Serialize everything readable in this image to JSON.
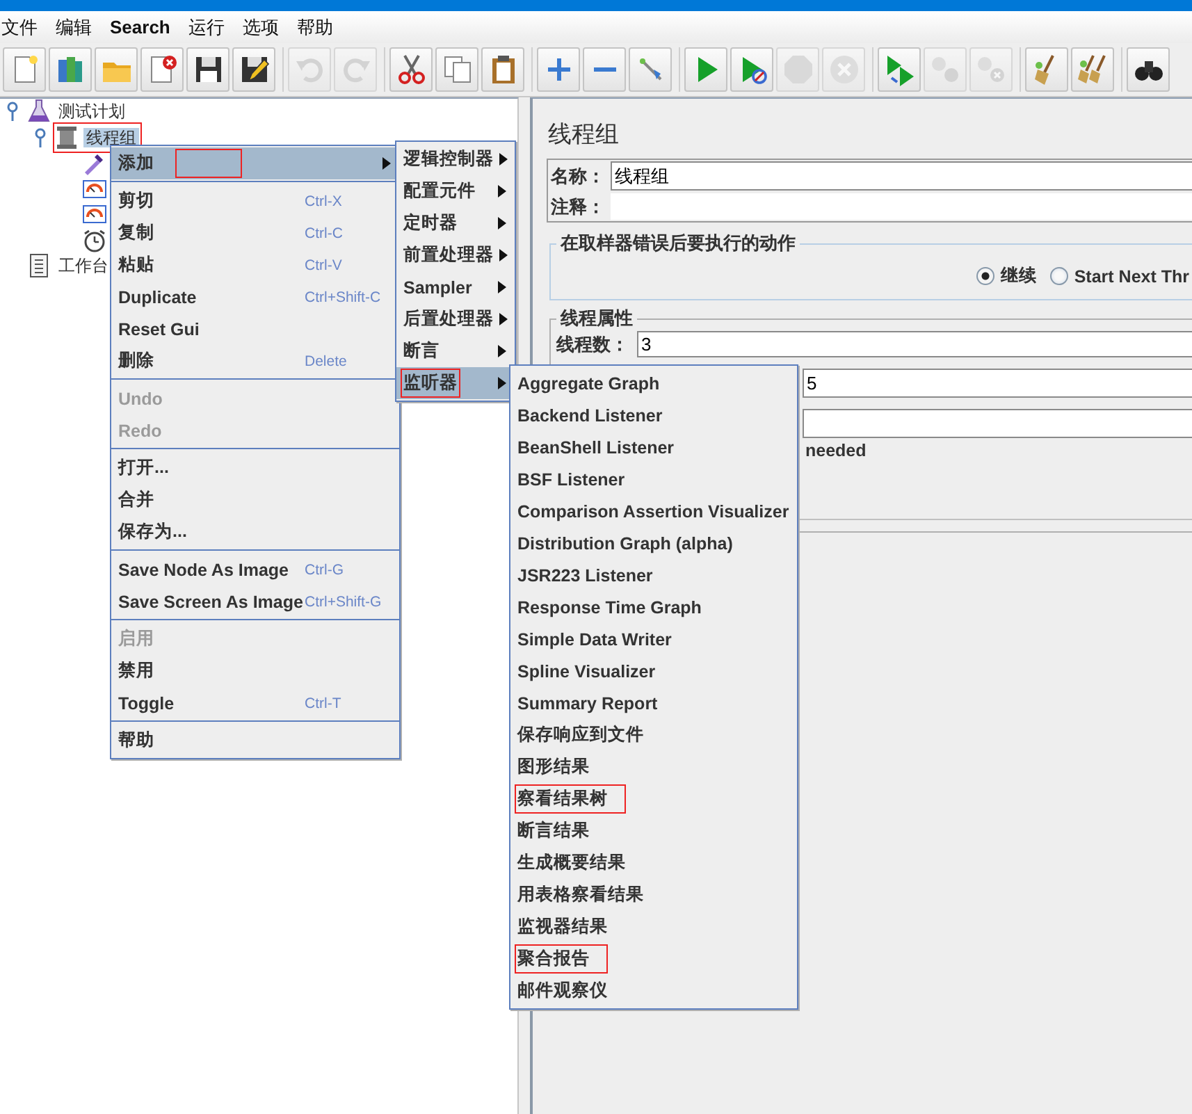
{
  "menubar": [
    "文件",
    "编辑",
    "Search",
    "运行",
    "选项",
    "帮助"
  ],
  "toolbar": [
    [
      {
        "kind": "new",
        "disabled": false
      },
      {
        "kind": "templates",
        "disabled": false
      },
      {
        "kind": "open",
        "disabled": false
      },
      {
        "kind": "close",
        "disabled": false
      },
      {
        "kind": "save",
        "disabled": false
      },
      {
        "kind": "saveas",
        "disabled": false
      }
    ],
    [
      {
        "kind": "undo",
        "disabled": true
      },
      {
        "kind": "redo",
        "disabled": true
      }
    ],
    [
      {
        "kind": "cut",
        "disabled": false
      },
      {
        "kind": "copy",
        "disabled": false
      },
      {
        "kind": "paste",
        "disabled": false
      }
    ],
    [
      {
        "kind": "add",
        "disabled": false
      },
      {
        "kind": "remove",
        "disabled": false
      },
      {
        "kind": "toggle",
        "disabled": false
      }
    ],
    [
      {
        "kind": "start",
        "disabled": false
      },
      {
        "kind": "start_no_timers",
        "disabled": false
      },
      {
        "kind": "stop",
        "disabled": true
      },
      {
        "kind": "shutdown",
        "disabled": true
      }
    ],
    [
      {
        "kind": "remote_start",
        "disabled": false
      },
      {
        "kind": "remote_stop",
        "disabled": true
      },
      {
        "kind": "remote_shutdown",
        "disabled": true
      }
    ],
    [
      {
        "kind": "clear",
        "disabled": false
      },
      {
        "kind": "clear_all",
        "disabled": false
      }
    ],
    [
      {
        "kind": "search",
        "disabled": false
      }
    ]
  ],
  "tree": [
    {
      "kind": "test_plan",
      "label": "测试计划",
      "selected": false,
      "marked": false,
      "expanded": true,
      "children": [
        {
          "kind": "thread_group",
          "label": "线程组",
          "selected": true,
          "marked": true,
          "expanded": true,
          "children": [
            {
              "kind": "sampler",
              "selected": false,
              "marked": false
            },
            {
              "kind": "listener",
              "selected": false,
              "marked": false
            },
            {
              "kind": "listener",
              "selected": false,
              "marked": false
            },
            {
              "kind": "timer",
              "selected": false,
              "marked": false
            }
          ]
        }
      ]
    },
    {
      "kind": "workbench",
      "label": "工作台",
      "selected": false,
      "marked": false
    }
  ],
  "context_menu": {
    "groups": [
      [
        {
          "label": "添加",
          "submenu": true,
          "selected": true,
          "disabled": false,
          "marked": true
        }
      ],
      [
        {
          "label": "剪切",
          "shortcut": "Ctrl-X",
          "submenu": false,
          "selected": false,
          "disabled": false,
          "marked": false
        },
        {
          "label": "复制",
          "shortcut": "Ctrl-C",
          "submenu": false,
          "selected": false,
          "disabled": false,
          "marked": false
        },
        {
          "label": "粘贴",
          "shortcut": "Ctrl-V",
          "submenu": false,
          "selected": false,
          "disabled": false,
          "marked": false
        },
        {
          "label": "Duplicate",
          "shortcut": "Ctrl+Shift-C",
          "submenu": false,
          "selected": false,
          "disabled": false,
          "marked": false
        },
        {
          "label": "Reset Gui",
          "submenu": false,
          "selected": false,
          "disabled": false,
          "marked": false
        },
        {
          "label": "删除",
          "shortcut": "Delete",
          "submenu": false,
          "selected": false,
          "disabled": false,
          "marked": false
        }
      ],
      [
        {
          "label": "Undo",
          "submenu": false,
          "selected": false,
          "disabled": true,
          "marked": false
        },
        {
          "label": "Redo",
          "submenu": false,
          "selected": false,
          "disabled": true,
          "marked": false
        }
      ],
      [
        {
          "label": "打开...",
          "submenu": false,
          "selected": false,
          "disabled": false,
          "marked": false
        },
        {
          "label": "合并",
          "submenu": false,
          "selected": false,
          "disabled": false,
          "marked": false
        },
        {
          "label": "保存为...",
          "submenu": false,
          "selected": false,
          "disabled": false,
          "marked": false
        }
      ],
      [
        {
          "label": "Save Node As Image",
          "shortcut": "Ctrl-G",
          "submenu": false,
          "selected": false,
          "disabled": false,
          "marked": false
        },
        {
          "label": "Save Screen As Image",
          "shortcut": "Ctrl+Shift-G",
          "submenu": false,
          "selected": false,
          "disabled": false,
          "marked": false
        }
      ],
      [
        {
          "label": "启用",
          "submenu": false,
          "selected": false,
          "disabled": true,
          "marked": false
        },
        {
          "label": "禁用",
          "submenu": false,
          "selected": false,
          "disabled": false,
          "marked": false
        },
        {
          "label": "Toggle",
          "shortcut": "Ctrl-T",
          "submenu": false,
          "selected": false,
          "disabled": false,
          "marked": false
        }
      ],
      [
        {
          "label": "帮助",
          "submenu": false,
          "selected": false,
          "disabled": false,
          "marked": false
        }
      ]
    ]
  },
  "add_menu": {
    "items": [
      {
        "label": "逻辑控制器",
        "submenu": true,
        "selected": false,
        "marked": false
      },
      {
        "label": "配置元件",
        "submenu": true,
        "selected": false,
        "marked": false
      },
      {
        "label": "定时器",
        "submenu": true,
        "selected": false,
        "marked": false
      },
      {
        "label": "前置处理器",
        "submenu": true,
        "selected": false,
        "marked": false
      },
      {
        "label": "Sampler",
        "submenu": true,
        "selected": false,
        "marked": false
      },
      {
        "label": "后置处理器",
        "submenu": true,
        "selected": false,
        "marked": false
      },
      {
        "label": "断言",
        "submenu": true,
        "selected": false,
        "marked": false
      },
      {
        "label": "监听器",
        "submenu": true,
        "selected": true,
        "marked": true
      }
    ]
  },
  "listener_menu": {
    "items": [
      {
        "label": "Aggregate Graph",
        "marked": false
      },
      {
        "label": "Backend Listener",
        "marked": false
      },
      {
        "label": "BeanShell Listener",
        "marked": false
      },
      {
        "label": "BSF Listener",
        "marked": false
      },
      {
        "label": "Comparison Assertion Visualizer",
        "marked": false
      },
      {
        "label": "Distribution Graph (alpha)",
        "marked": false
      },
      {
        "label": "JSR223 Listener",
        "marked": false
      },
      {
        "label": "Response Time Graph",
        "marked": false
      },
      {
        "label": "Simple Data Writer",
        "marked": false
      },
      {
        "label": "Spline Visualizer",
        "marked": false
      },
      {
        "label": "Summary Report",
        "marked": false
      },
      {
        "label": "保存响应到文件",
        "marked": false
      },
      {
        "label": "图形结果",
        "marked": false
      },
      {
        "label": "察看结果树",
        "marked": true
      },
      {
        "label": "断言结果",
        "marked": false
      },
      {
        "label": "生成概要结果",
        "marked": false
      },
      {
        "label": "用表格察看结果",
        "marked": false
      },
      {
        "label": "监视器结果",
        "marked": false
      },
      {
        "label": "聚合报告",
        "marked": true
      },
      {
        "label": "邮件观察仪",
        "marked": false
      }
    ]
  },
  "editor": {
    "title": "线程组",
    "name_label": "名称：",
    "name_value": "线程组",
    "comment_label": "注释：",
    "error_action": {
      "title": "在取样器错误后要执行的动作",
      "options": [
        {
          "label": "继续",
          "selected": true
        },
        {
          "label": "Start Next Thr",
          "selected": false
        }
      ]
    },
    "thread_properties": {
      "title": "线程属性",
      "fields": [
        {
          "kind": "field",
          "label": "线程数：",
          "value": "3"
        },
        {
          "kind": "field",
          "value": "5"
        },
        {
          "kind": "field"
        }
      ],
      "note": "needed"
    }
  }
}
